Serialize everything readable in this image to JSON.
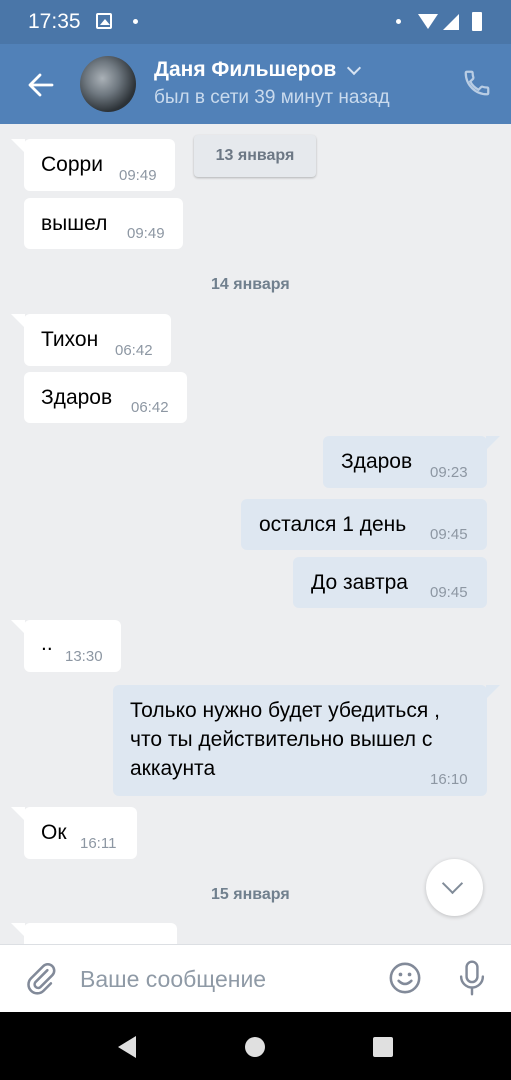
{
  "status_bar": {
    "time": "17:35",
    "icons": [
      "image-icon",
      "dot-icon",
      "wifi-icon",
      "signal-icon",
      "battery-icon"
    ]
  },
  "header": {
    "contact_name": "Даня Фильшеров",
    "contact_status": "был в сети 39 минут назад",
    "icons": [
      "back-arrow-icon",
      "chevron-down-icon",
      "phone-icon"
    ]
  },
  "chat": {
    "floating_date": "13 января",
    "dates": {
      "jan14": "14 января",
      "jan15": "15 января"
    },
    "messages": [
      {
        "dir": "in",
        "text": "Сорри",
        "time": "09:49"
      },
      {
        "dir": "in",
        "text": "вышел",
        "time": "09:49"
      },
      {
        "dir": "in",
        "text": "Тихон",
        "time": "06:42"
      },
      {
        "dir": "in",
        "text": "Здаров",
        "time": "06:42"
      },
      {
        "dir": "out",
        "text": "Здаров",
        "time": "09:23"
      },
      {
        "dir": "out",
        "text": "остался 1 день",
        "time": "09:45"
      },
      {
        "dir": "out",
        "text": "До завтра",
        "time": "09:45"
      },
      {
        "dir": "in",
        "text": "..",
        "time": "13:30"
      },
      {
        "dir": "out",
        "lines": [
          "Только нужно будет убедиться ,",
          "что ты действительно вышел с",
          "аккаунта"
        ],
        "time": "16:10"
      },
      {
        "dir": "in",
        "text": "Ок",
        "time": "16:11"
      }
    ]
  },
  "composer": {
    "placeholder": "Ваше сообщение",
    "icons": [
      "paperclip-icon",
      "emoji-icon",
      "microphone-icon"
    ]
  },
  "colors": {
    "header": "#5181b8",
    "status_bar": "#4a76a8",
    "outgoing_bubble": "#dee7f1",
    "background": "#edeef0"
  }
}
